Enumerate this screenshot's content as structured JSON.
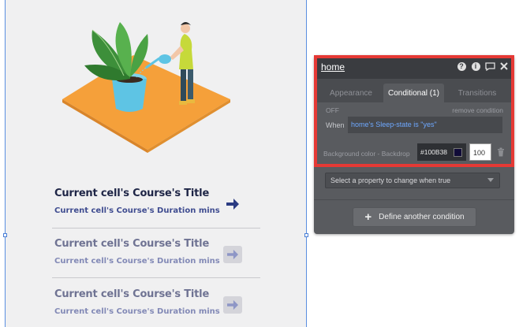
{
  "page": {
    "courses": [
      {
        "title": "Current cell's Course's Title",
        "subtitle": "Current cell's Course's Duration mins"
      },
      {
        "title": "Current cell's Course's Title",
        "subtitle": "Current cell's Course's Duration mins"
      },
      {
        "title": "Current cell's Course's Title",
        "subtitle": "Current cell's Course's Duration mins"
      }
    ],
    "illustration": "woman-watering-plant-illustration"
  },
  "panel": {
    "title": "home",
    "icons": [
      "help-icon",
      "info-icon",
      "comment-icon",
      "close-icon"
    ],
    "tabs": [
      {
        "label": "Appearance",
        "active": false
      },
      {
        "label": "Conditional (1)",
        "active": true
      },
      {
        "label": "Transitions",
        "active": false
      }
    ],
    "condition": {
      "state_label": "OFF",
      "remove_label": "remove condition",
      "when_label": "When",
      "when_value": "home's Sleep-state is \"yes\"",
      "property_label": "Background color - Backdrop",
      "color_value": "#100B38",
      "color_swatch": "#100B38",
      "opacity_value": "100"
    },
    "select_placeholder": "Select a property to change when true",
    "define_button": "Define another condition"
  },
  "colors": {
    "highlight": "#e53935",
    "panel_bg": "#595b5f",
    "link": "#6ea8ff",
    "course_title": "#1e2546"
  }
}
